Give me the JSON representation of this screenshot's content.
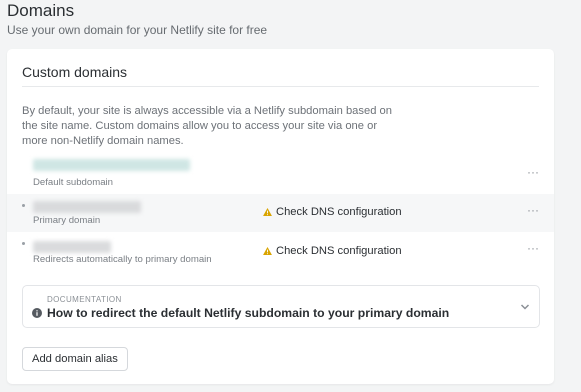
{
  "page": {
    "title": "Domains",
    "subtitle": "Use your own domain for your Netlify site for free"
  },
  "card": {
    "title": "Custom domains",
    "description": "By default, your site is always accessible via a Netlify subdomain based on the site name. Custom domains allow you to access your site via one or more non-Netlify domain names."
  },
  "domains": [
    {
      "sublabel": "Default subdomain",
      "warning": "",
      "options_icon": "ellipsis-icon"
    },
    {
      "sublabel": "Primary domain",
      "warning": "Check DNS configuration",
      "options_icon": "ellipsis-icon"
    },
    {
      "sublabel": "Redirects automatically to primary domain",
      "warning": "Check DNS configuration",
      "options_icon": "ellipsis-icon"
    }
  ],
  "options_glyph": "···",
  "documentation": {
    "label": "DOCUMENTATION",
    "link": "How to redirect the default Netlify subdomain to your primary domain"
  },
  "actions": {
    "add_alias": "Add domain alias"
  },
  "colors": {
    "warning": "#d9a400",
    "accent_teal": "#cfe6e4"
  }
}
